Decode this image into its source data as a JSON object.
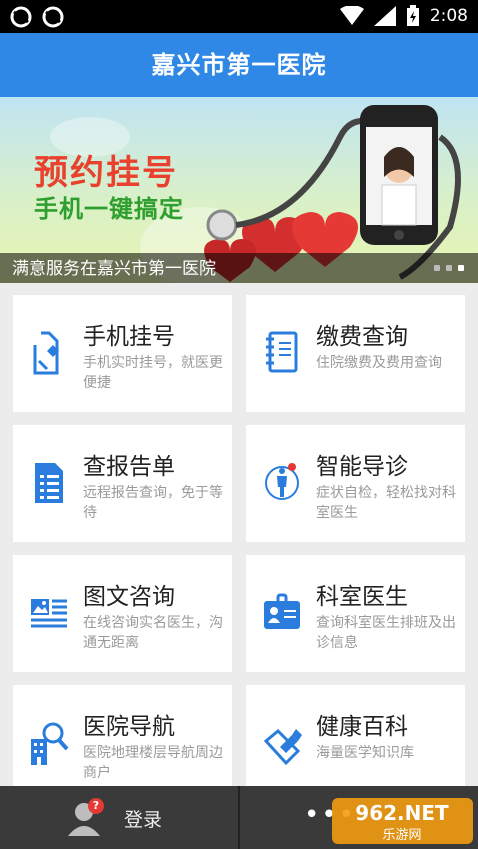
{
  "status_bar": {
    "time": "2:08"
  },
  "app": {
    "title": "嘉兴市第一医院"
  },
  "banner": {
    "headline": "预约挂号",
    "subline": "手机一键搞定",
    "caption": "满意服务在嘉兴市第一医院",
    "page_count": 3,
    "active_page": 3
  },
  "menu": [
    {
      "title": "手机挂号",
      "desc": "手机实时挂号，就医更便捷",
      "icon": "phone-register-icon"
    },
    {
      "title": "缴费查询",
      "desc": "住院缴费及费用查询",
      "icon": "notebook-icon"
    },
    {
      "title": "查报告单",
      "desc": "远程报告查询，免于等待",
      "icon": "report-icon"
    },
    {
      "title": "智能导诊",
      "desc": "症状自检，轻松找对科室医生",
      "icon": "body-guide-icon"
    },
    {
      "title": "图文咨询",
      "desc": "在线咨询实名医生，沟通无距离",
      "icon": "image-text-icon"
    },
    {
      "title": "科室医生",
      "desc": "查询科室医生排班及出诊信息",
      "icon": "doctor-badge-icon"
    },
    {
      "title": "医院导航",
      "desc": "医院地理楼层导航周边商户",
      "icon": "hospital-search-icon"
    },
    {
      "title": "健康百科",
      "desc": "海量医学知识库",
      "icon": "pencil-book-icon"
    }
  ],
  "bottom_bar": {
    "login_label": "登录",
    "notification_badge": "?",
    "more_label": "•••"
  },
  "watermark": {
    "text": "962.NET",
    "subtext": "乐游网"
  },
  "colors": {
    "accent": "#2f87e6",
    "icon_blue": "#2a7ddc"
  }
}
